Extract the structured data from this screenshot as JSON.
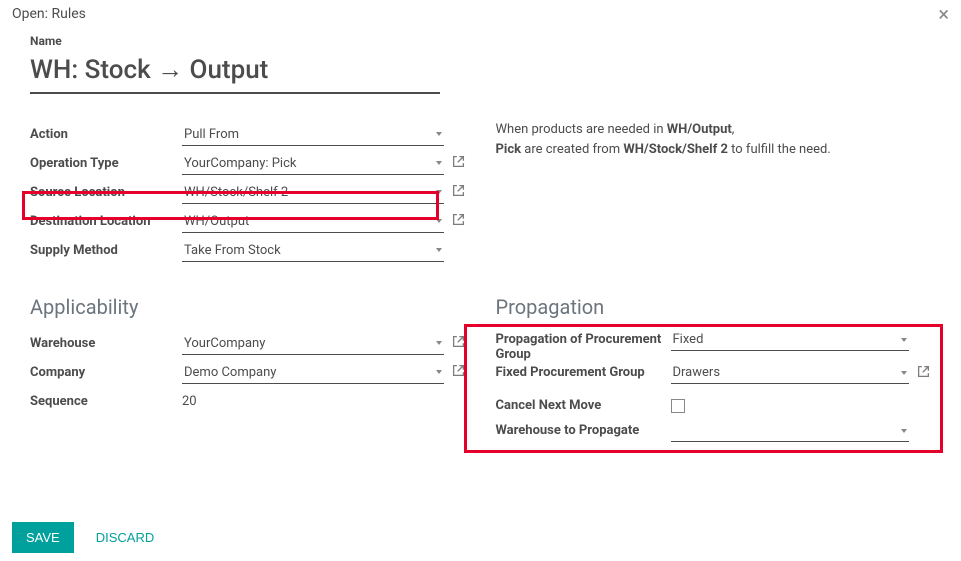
{
  "modal": {
    "title": "Open: Rules",
    "close": "×"
  },
  "name": {
    "label": "Name",
    "value": "WH: Stock → Output"
  },
  "leftFields": {
    "action": {
      "label": "Action",
      "value": "Pull From"
    },
    "opType": {
      "label": "Operation Type",
      "value": "YourCompany: Pick"
    },
    "srcLoc": {
      "label": "Source Location",
      "value": "WH/Stock/Shelf 2"
    },
    "dstLoc": {
      "label": "Destination Location",
      "value": "WH/Output"
    },
    "supply": {
      "label": "Supply Method",
      "value": "Take From Stock"
    }
  },
  "desc": {
    "p1a": "When products are needed in ",
    "p1b": "WH/Output",
    "p1c": ",",
    "p2a": "Pick",
    "p2b": " are created from ",
    "p2c": "WH/Stock/Shelf 2",
    "p2d": " to fulfill the need."
  },
  "applicability": {
    "title": "Applicability",
    "warehouse": {
      "label": "Warehouse",
      "value": "YourCompany"
    },
    "company": {
      "label": "Company",
      "value": "Demo Company"
    },
    "sequence": {
      "label": "Sequence",
      "value": "20"
    }
  },
  "propagation": {
    "title": "Propagation",
    "propGroup": {
      "label": "Propagation of Procurement Group",
      "value": "Fixed"
    },
    "fixedGroup": {
      "label": "Fixed Procurement Group",
      "value": "Drawers"
    },
    "cancelNext": {
      "label": "Cancel Next Move"
    },
    "whProp": {
      "label": "Warehouse to Propagate",
      "value": ""
    }
  },
  "footer": {
    "save": "Save",
    "discard": "Discard"
  }
}
